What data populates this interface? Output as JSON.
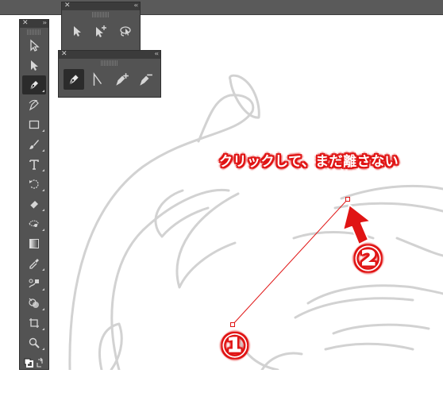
{
  "colors": {
    "panel_bg": "#535353",
    "panel_header": "#3b3b3b",
    "icon": "#d6d6d6",
    "path_line": "#e01414",
    "sketch": "#cfcfcf",
    "annotation": "#e01414"
  },
  "tools_panel": {
    "close_label": "✕",
    "collapse_label": "››",
    "tools": [
      {
        "name": "direct-selection-icon",
        "active": false
      },
      {
        "name": "selection-icon",
        "active": false
      },
      {
        "name": "pen-tool-icon",
        "active": true
      },
      {
        "name": "curvature-tool-icon",
        "active": false
      },
      {
        "name": "rectangle-tool-icon",
        "active": false
      },
      {
        "name": "paintbrush-tool-icon",
        "active": false
      },
      {
        "name": "type-tool-icon",
        "active": false
      },
      {
        "name": "rotate-tool-icon",
        "active": false
      },
      {
        "name": "eraser-tool-icon",
        "active": false
      },
      {
        "name": "puppet-warp-tool-icon",
        "active": false
      },
      {
        "name": "gradient-tool-icon",
        "active": false
      },
      {
        "name": "eyedropper-tool-icon",
        "active": false
      },
      {
        "name": "blend-tool-icon",
        "active": false
      },
      {
        "name": "shape-builder-tool-icon",
        "active": false
      },
      {
        "name": "artboard-tool-icon",
        "active": false
      },
      {
        "name": "zoom-tool-icon",
        "active": false
      },
      {
        "name": "fill-stroke-icon",
        "active": false
      }
    ]
  },
  "selection_panel": {
    "close_label": "✕",
    "collapse_label": "‹‹",
    "tools": [
      "selection-icon",
      "add-anchor-selection-icon",
      "lasso-tool-icon"
    ]
  },
  "pen_panel": {
    "close_label": "✕",
    "collapse_label": "‹‹",
    "tools": [
      "pen-tool-icon",
      "anchor-point-tool-icon",
      "add-anchor-point-tool-icon",
      "delete-anchor-point-tool-icon"
    ]
  },
  "annotation": {
    "instruction": "クリックして、まだ離さない",
    "step1": "①",
    "step2": "②"
  }
}
